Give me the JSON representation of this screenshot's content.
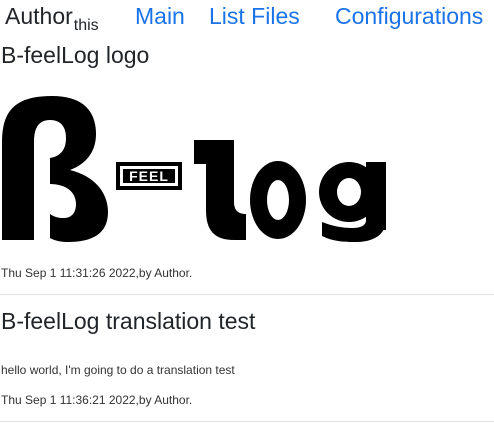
{
  "nav": {
    "brand": "Author",
    "brand_sub": "this",
    "links": [
      "Main",
      "List Files",
      "Configurations"
    ]
  },
  "posts": [
    {
      "title": "B-feelLog logo",
      "logo": {
        "mark": "B-feelLog logo image",
        "badge_text": "FEEL"
      },
      "meta": "Thu Sep 1 11:31:26 2022,by Author."
    },
    {
      "title": "B-feelLog translation test",
      "body": "hello world, I'm going to do a translation test",
      "meta": "Thu Sep 1 11:36:21 2022,by Author."
    }
  ],
  "colors": {
    "link": "#1a73e8",
    "text": "#212529",
    "divider": "#e2e2e2"
  }
}
